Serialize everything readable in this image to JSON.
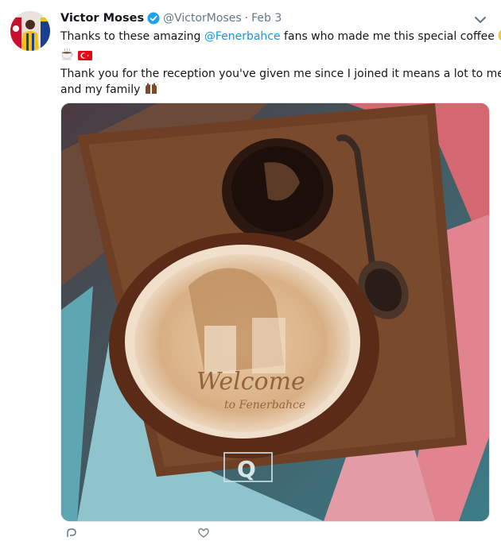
{
  "tweet": {
    "display_name": "Victor Moses",
    "handle": "@VictorMoses",
    "separator": "·",
    "date": "Feb 3",
    "line1_prefix": "Thanks to these amazing ",
    "mention": "@Fenerbahce",
    "line1_suffix": " fans who made me this special coffee",
    "line3": "Thank you for the reception you've given me since I joined it means a lot to me",
    "line4": "and my family",
    "emojis": [
      "grinning-face",
      "hot-beverage",
      "turkey-flag",
      "raised-hands"
    ]
  },
  "media": {
    "latte_art_text_1": "Welcome",
    "latte_art_text_2": "to Fenerbahce",
    "tray_logo_letter": "Q"
  },
  "colors": {
    "link": "#1b95e0",
    "secondary_text": "#657786",
    "verified": "#1da1f2"
  },
  "icons": [
    "verified-badge-icon",
    "chevron-down-icon",
    "reply-icon",
    "like-icon"
  ]
}
